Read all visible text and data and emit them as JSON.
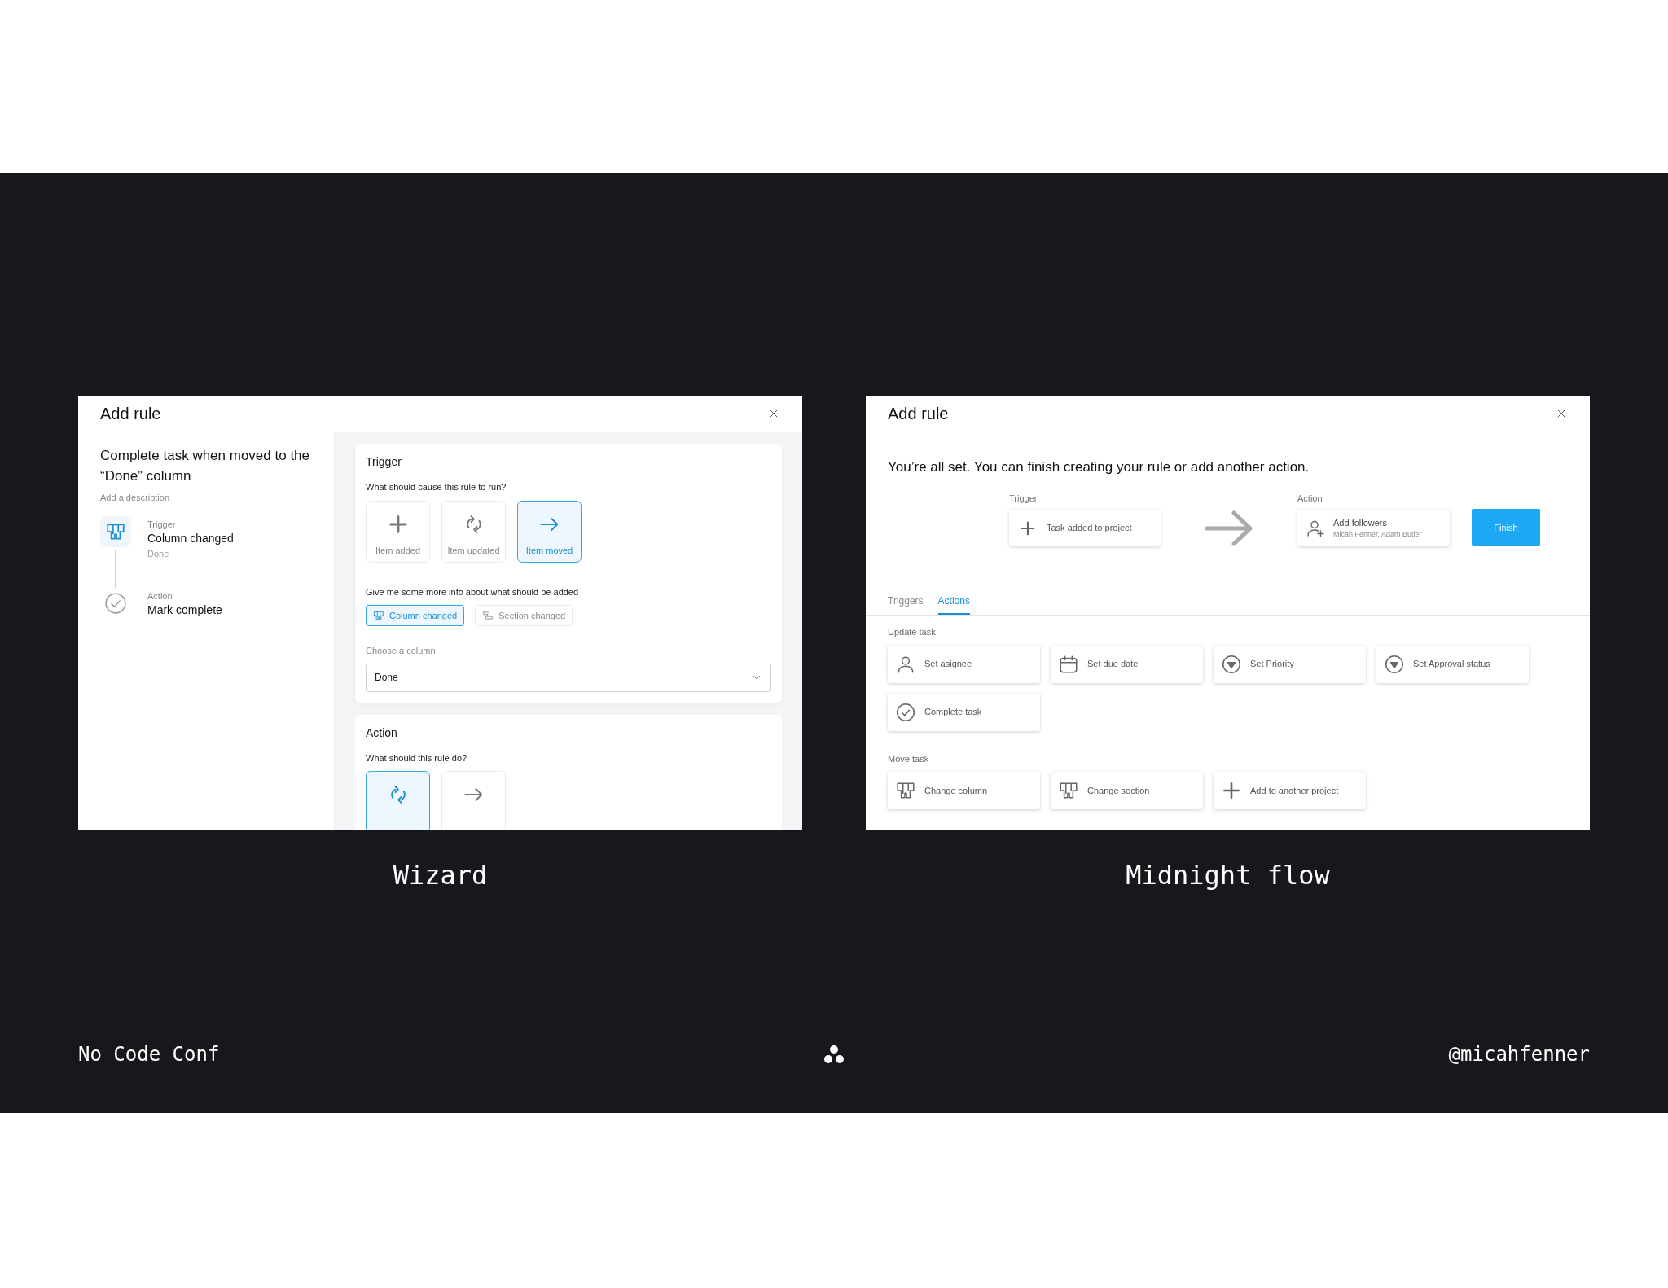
{
  "slide": {
    "panels": [
      {
        "kind": "wizard",
        "title": "Add rule",
        "caption": "Wizard",
        "summary": {
          "title": "Complete task when moved to the “Done” column",
          "description_link": "Add a description",
          "steps": [
            {
              "kind": "trigger",
              "label": "Trigger",
              "value": "Column changed",
              "detail": "Done"
            },
            {
              "kind": "action",
              "label": "Action",
              "value": "Mark complete"
            }
          ]
        },
        "trigger_section": {
          "title": "Trigger",
          "question": "What should cause this rule to run?",
          "options": [
            {
              "kind": "plus",
              "label": "Item added",
              "selected": false
            },
            {
              "kind": "cycle",
              "label": "Item updated",
              "selected": false
            },
            {
              "kind": "arrow",
              "label": "Item moved",
              "selected": true
            }
          ],
          "more_info": "Give me some more info about what should be added",
          "chips": [
            {
              "kind": "columns",
              "label": "Column changed",
              "selected": true
            },
            {
              "kind": "section",
              "label": "Section changed",
              "selected": false
            }
          ],
          "select": {
            "label": "Choose a column",
            "value": "Done"
          }
        },
        "action_section": {
          "title": "Action",
          "question": "What should this rule do?",
          "options": [
            {
              "kind": "cycle",
              "selected": true
            },
            {
              "kind": "arrow",
              "selected": false
            }
          ]
        }
      },
      {
        "kind": "flow",
        "title": "Add rule",
        "caption": "Midnight flow",
        "message": "You’re all set. You can finish creating your rule or add another action.",
        "trigger": {
          "label": "Trigger",
          "kind": "plus",
          "text": "Task added to project"
        },
        "action": {
          "label": "Action",
          "kind": "personplus",
          "title": "Add followers",
          "subtitle": "Micah Fenner, Adam Butler"
        },
        "finish_button": "Finish",
        "tabs": [
          {
            "label": "Triggers",
            "selected": false
          },
          {
            "label": "Actions",
            "selected": true
          }
        ],
        "groups": [
          {
            "title": "Update task",
            "items": [
              {
                "kind": "person",
                "label": "Set asignee"
              },
              {
                "kind": "calendar",
                "label": "Set due date"
              },
              {
                "kind": "priority",
                "label": "Set Priority"
              },
              {
                "kind": "priority",
                "label": "Set Approval status"
              },
              {
                "kind": "check",
                "label": "Complete task"
              }
            ]
          },
          {
            "title": "Move task",
            "items": [
              {
                "kind": "columns",
                "label": "Change column"
              },
              {
                "kind": "columns",
                "label": "Change section"
              },
              {
                "kind": "plus",
                "label": "Add to another project"
              }
            ]
          }
        ]
      }
    ],
    "footer": {
      "left": "No Code Conf",
      "right": "@micahfenner"
    }
  }
}
